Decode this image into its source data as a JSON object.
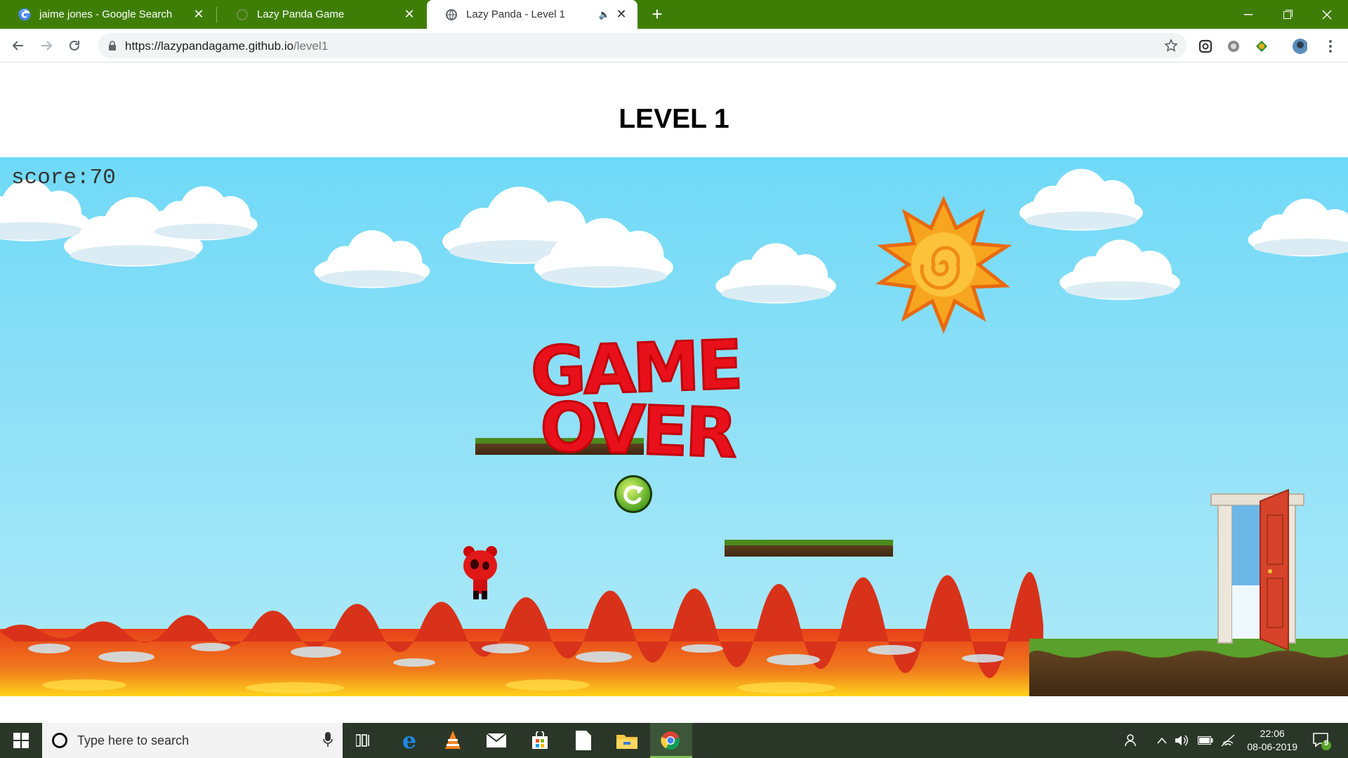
{
  "browser": {
    "tabs": [
      {
        "title": "jaime jones - Google Search",
        "favicon": "google-icon",
        "active": false
      },
      {
        "title": "Lazy Panda Game",
        "favicon": "globe-icon",
        "active": false
      },
      {
        "title": "Lazy Panda - Level 1",
        "favicon": "globe-icon",
        "active": true
      }
    ],
    "url_host": "https://lazypandagame.github.io",
    "url_path": "/level1",
    "new_tab_label": "+",
    "accent_color": "#3f7e06"
  },
  "page": {
    "title": "LEVEL 1"
  },
  "game": {
    "score_label": "score:70",
    "game_over_line1": "GAME",
    "game_over_line2": "OVER",
    "game_over_color": "#e8101a",
    "restart_icon": "restart-icon",
    "player": "panda-icon",
    "hazard": "lava",
    "exit": "door-icon"
  },
  "taskbar": {
    "search_placeholder": "Type here to search",
    "time": "22:06",
    "date": "08-06-2019",
    "notification_count": "9"
  }
}
